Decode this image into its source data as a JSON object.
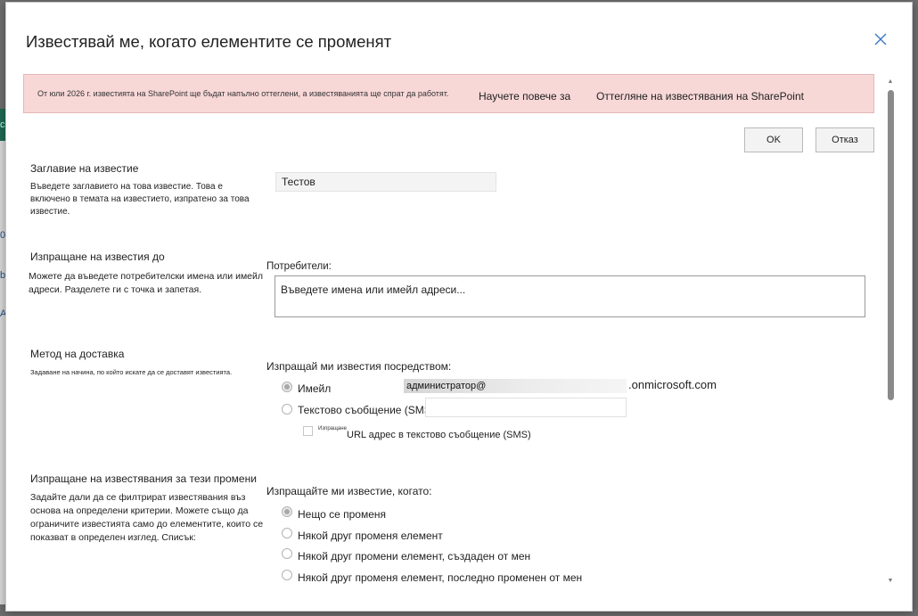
{
  "background": {
    "letters": [
      "c",
      "0",
      "b",
      "A"
    ]
  },
  "dialog": {
    "title": "Известявай ме, когато елементите се променят"
  },
  "banner": {
    "message": "От юли 2026 г. известията на SharePoint ще бъдат напълно оттеглени, а известяванията ще спрат да работят.",
    "link1": "Научете повече за",
    "link2": "Оттегляне на известявания на SharePoint"
  },
  "buttons": {
    "ok": "OK",
    "cancel": "Отказ"
  },
  "section_title": {
    "heading": "Заглавие на известие",
    "description": "Въведете заглавието на това известие. Това е включено в темата на известието, изпратено за това известие.",
    "value": "Тестов"
  },
  "section_recipients": {
    "heading": "Изпращане на известия до",
    "description": "Можете да въведете потребителски имена или имейл адреси. Разделете ги с точка и запетая.",
    "field_label": "Потребители:",
    "placeholder": "Въведете имена или имейл адреси..."
  },
  "section_delivery": {
    "heading": "Метод на доставка",
    "description": "Задаване на начина, по който искате да се доставят известията.",
    "field_label": "Изпращай ми известия посредством:",
    "options": [
      {
        "label": "Имейл",
        "checked": true
      },
      {
        "label": "Текстово съобщение (SMS)",
        "checked": false
      }
    ],
    "email_local": "администратор@",
    "email_domain": ".onmicrosoft.com",
    "sms_checkbox_tiny": "Изпращане",
    "sms_checkbox_label": "URL адрес в текстово съобщение (SMS)"
  },
  "section_changes": {
    "heading": "Изпращане на известявания за тези промени",
    "description": "Задайте дали да се филтрират известявания въз основа на определени критерии. Можете също да ограничите известията само до елементите, които се показват в определен изглед. Списък:",
    "field_label": "Изпращайте ми известие, когато:",
    "options": [
      {
        "label": "Нещо се променя",
        "checked": true
      },
      {
        "label": "Някой друг променя елемент",
        "checked": false
      },
      {
        "label": "Някой друг промени елемент, създаден от мен",
        "checked": false
      },
      {
        "label": "Някой друг променя елемент, последно променен от мен",
        "checked": false
      }
    ]
  }
}
